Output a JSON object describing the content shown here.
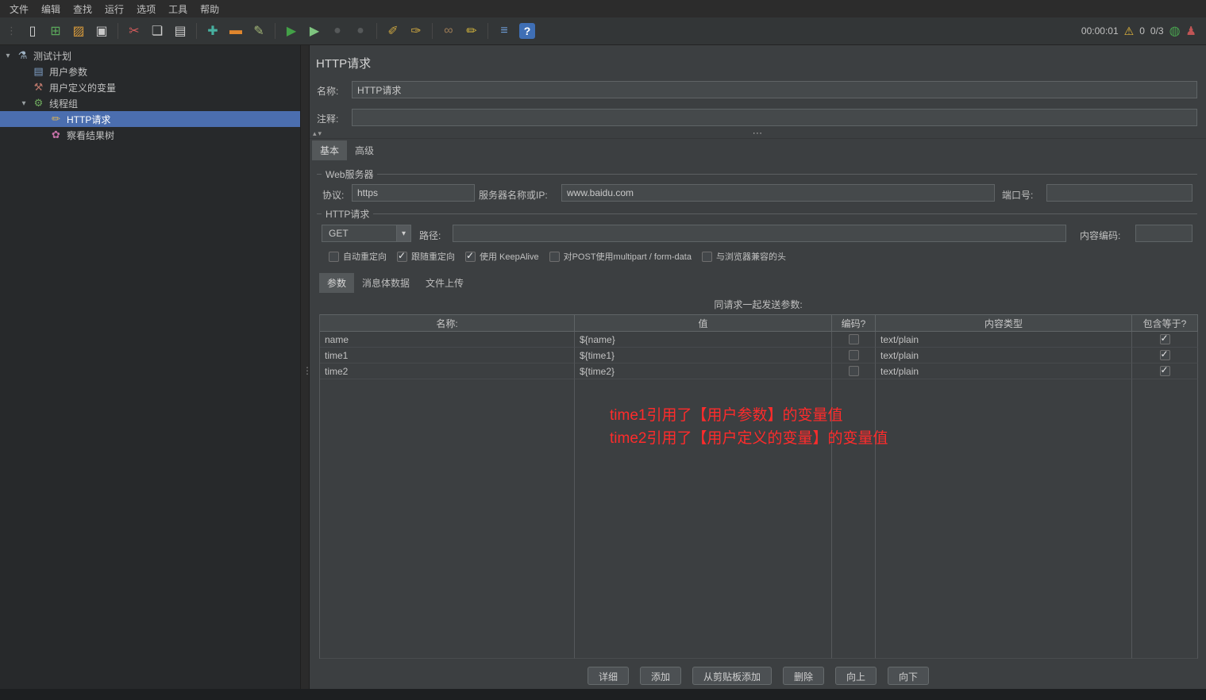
{
  "menubar": {
    "items": [
      {
        "label": "文件"
      },
      {
        "label": "编辑"
      },
      {
        "label": "查找"
      },
      {
        "label": "运行"
      },
      {
        "label": "选项"
      },
      {
        "label": "工具"
      },
      {
        "label": "帮助"
      }
    ]
  },
  "toolbar": {
    "icons": [
      {
        "name": "new-file",
        "glyph": "▯",
        "color": "#d9d9d9"
      },
      {
        "name": "templates",
        "glyph": "⊞",
        "color": "#5ba85b"
      },
      {
        "name": "open-file",
        "glyph": "▨",
        "color": "#d89b3c"
      },
      {
        "name": "save",
        "glyph": "▣",
        "color": "#c8c8c8"
      },
      {
        "name": "cut",
        "glyph": "✂",
        "color": "#d65c5c"
      },
      {
        "name": "copy",
        "glyph": "❏",
        "color": "#cfcfcf"
      },
      {
        "name": "paste",
        "glyph": "▤",
        "color": "#cfcfcf"
      },
      {
        "name": "add",
        "glyph": "✚",
        "color": "#47b0a0"
      },
      {
        "name": "remove",
        "glyph": "▬",
        "color": "#e0862d"
      },
      {
        "name": "toggle",
        "glyph": "✎",
        "color": "#a4b878"
      },
      {
        "name": "start",
        "glyph": "▶",
        "color": "#43a047"
      },
      {
        "name": "start-no-pauses",
        "glyph": "▶",
        "color": "#7ec47f"
      },
      {
        "name": "stop",
        "glyph": "●",
        "color": "#56595a"
      },
      {
        "name": "shutdown",
        "glyph": "●",
        "color": "#56595a"
      },
      {
        "name": "clear",
        "glyph": "✐",
        "color": "#c9a441"
      },
      {
        "name": "clear-all",
        "glyph": "✑",
        "color": "#c9a441"
      },
      {
        "name": "search",
        "glyph": "∞",
        "color": "#9a7a55"
      },
      {
        "name": "reset-search",
        "glyph": "✏",
        "color": "#d0b23c"
      },
      {
        "name": "function-helper",
        "glyph": "≡",
        "color": "#6f9fd8"
      },
      {
        "name": "help",
        "glyph": "?",
        "color": "#ffffff"
      }
    ],
    "elapsed_time": "00:00:01",
    "warning_glyph": "⚠",
    "warning_count": "0",
    "thread_count": "0/3",
    "remote_glyph": "◍",
    "users_glyph": "♟"
  },
  "glyphs": {
    "grip_dots": "⋮",
    "expander": "▾",
    "splitter_arrows": "▴▾",
    "splitter_dots": "⋯",
    "dropdown_arrow": "▾"
  },
  "tree": {
    "items": [
      {
        "label": "测试计划",
        "icon": "test-plan",
        "icon_glyph": "⚗",
        "icon_color": "#9fb3c4",
        "expanded": true
      },
      {
        "label": "用户参数",
        "icon": "user-parameters",
        "icon_glyph": "▤",
        "icon_color": "#7f9fc6"
      },
      {
        "label": "用户定义的变量",
        "icon": "user-defined-variables",
        "icon_glyph": "⚒",
        "icon_color": "#b8766a"
      },
      {
        "label": "线程组",
        "icon": "thread-group",
        "icon_glyph": "⚙",
        "icon_color": "#6faa5e",
        "expanded": true
      },
      {
        "label": "HTTP请求",
        "icon": "http-request",
        "icon_glyph": "✏",
        "icon_color": "#d8b25a",
        "selected": true
      },
      {
        "label": "察看结果树",
        "icon": "view-results-tree",
        "icon_glyph": "✿",
        "icon_color": "#c671a8"
      }
    ]
  },
  "main": {
    "title": "HTTP请求",
    "name": {
      "label": "名称:",
      "value": "HTTP请求"
    },
    "comment": {
      "label": "注释:",
      "value": ""
    },
    "tabs": [
      {
        "label": "基本",
        "active": true
      },
      {
        "label": "高级",
        "active": false
      }
    ],
    "web_server": {
      "group_title": "Web服务器",
      "protocol": {
        "label": "协议:",
        "value": "https"
      },
      "server": {
        "label": "服务器名称或IP:",
        "value": "www.baidu.com"
      },
      "port": {
        "label": "端口号:",
        "value": ""
      }
    },
    "http_request": {
      "group_title": "HTTP请求",
      "method": "GET",
      "path": {
        "label": "路径:",
        "value": ""
      },
      "content_encoding": {
        "label": "内容编码:",
        "value": ""
      },
      "options": [
        {
          "label": "自动重定向",
          "checked": false
        },
        {
          "label": "跟随重定向",
          "checked": true
        },
        {
          "label": "使用 KeepAlive",
          "checked": true
        },
        {
          "label": "对POST使用multipart / form-data",
          "checked": false
        },
        {
          "label": "与浏览器兼容的头",
          "checked": false
        }
      ]
    },
    "param_tabs": [
      {
        "label": "参数",
        "active": true
      },
      {
        "label": "消息体数据",
        "active": false
      },
      {
        "label": "文件上传",
        "active": false
      }
    ],
    "params_table": {
      "caption": "同请求一起发送参数:",
      "columns": [
        "名称:",
        "值",
        "编码?",
        "内容类型",
        "包含等于?"
      ],
      "rows": [
        {
          "name": "name",
          "value": "${name}",
          "encoded": false,
          "content_type": "text/plain",
          "include_equals": true
        },
        {
          "name": "time1",
          "value": "${time1}",
          "encoded": false,
          "content_type": "text/plain",
          "include_equals": true
        },
        {
          "name": "time2",
          "value": "${time2}",
          "encoded": false,
          "content_type": "text/plain",
          "include_equals": true
        }
      ]
    },
    "annotation": {
      "color": "#ff2b2b",
      "lines": [
        "time1引用了【用户参数】的变量值",
        "time2引用了【用户定义的变量】的变量值"
      ]
    },
    "buttons": [
      {
        "label": "详细"
      },
      {
        "label": "添加"
      },
      {
        "label": "从剪贴板添加"
      },
      {
        "label": "删除"
      },
      {
        "label": "向上"
      },
      {
        "label": "向下"
      }
    ]
  }
}
